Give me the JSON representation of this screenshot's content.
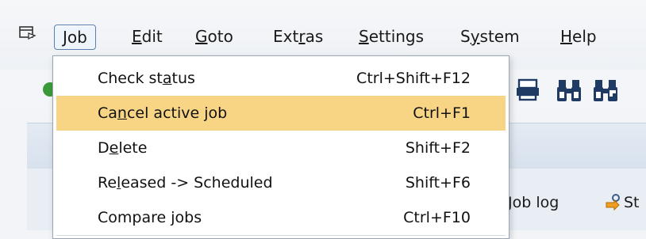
{
  "menubar": {
    "items": [
      {
        "label": "Job",
        "underline_index": 0
      },
      {
        "label": "Edit",
        "underline_index": 0
      },
      {
        "label": "Goto",
        "underline_index": 0
      },
      {
        "label": "Extras",
        "underline_index": 3
      },
      {
        "label": "Settings",
        "underline_index": 0
      },
      {
        "label": "System",
        "underline_index": 1
      },
      {
        "label": "Help",
        "underline_index": 0
      }
    ]
  },
  "dropdown": {
    "items": [
      {
        "label": "Check status",
        "shortcut": "Ctrl+Shift+F12",
        "highlighted": false
      },
      {
        "label": "Cancel active job",
        "shortcut": "Ctrl+F1",
        "highlighted": true
      },
      {
        "label": "Delete",
        "shortcut": "Shift+F2",
        "highlighted": false
      },
      {
        "label": "Released -> Scheduled",
        "shortcut": "Shift+F6",
        "highlighted": false
      },
      {
        "label": "Compare jobs",
        "shortcut": "Ctrl+F10",
        "highlighted": false
      }
    ]
  },
  "appbar": {
    "job_log_label": "Job log",
    "step_label_partial": "St"
  },
  "colors": {
    "highlight": "#f7d585",
    "menu_open_border": "#5a7fb0"
  },
  "icons": [
    "menu-toggle-icon",
    "print-icon",
    "find-icon",
    "find-next-icon",
    "step-icon",
    "enter-icon"
  ]
}
